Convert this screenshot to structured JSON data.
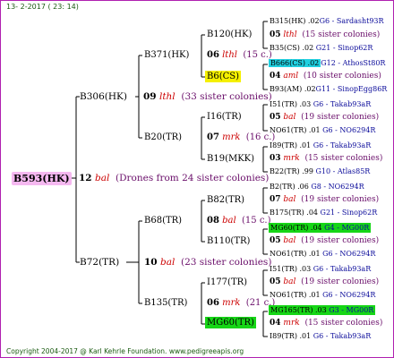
{
  "header": {
    "date": "13- 2-2017 ( 23: 14)"
  },
  "root": {
    "id": "B593(HK)",
    "drones_num": "12",
    "race": "bal",
    "note": "(Drones from 24 sister colonies)"
  },
  "gen2": [
    {
      "id": "B306(HK)",
      "num": "09",
      "race": "lthl",
      "note": "(33 sister colonies)"
    },
    {
      "id": "B72(TR)",
      "num": "10",
      "race": "bal",
      "note": "(23 sister colonies)"
    }
  ],
  "gen3": [
    {
      "id": "B371(HK)",
      "num": "06",
      "race": "lthl",
      "note": "(15 c.)"
    },
    {
      "id": "B20(TR)",
      "num": "07",
      "race": "mrk",
      "note": "(16 c.)"
    },
    {
      "id": "B68(TR)",
      "num": "08",
      "race": "bal",
      "note": "(15 c.)"
    },
    {
      "id": "B135(TR)",
      "num": "06",
      "race": "mrk",
      "note": "(21 c.)"
    }
  ],
  "gen4": [
    {
      "id": "B120(HK)",
      "num": "05",
      "race": "lthl",
      "note": "(15 sister colonies)"
    },
    {
      "id": "B6(CS)",
      "num": "04",
      "race": "aml",
      "note": "(10 sister colonies)"
    },
    {
      "id": "I16(TR)",
      "num": "05",
      "race": "bal",
      "note": "(19 sister colonies)"
    },
    {
      "id": "B19(MKK)",
      "num": "03",
      "race": "mrk",
      "note": "(15 sister colonies)"
    },
    {
      "id": "B82(TR)",
      "num": "07",
      "race": "bal",
      "note": "(19 sister colonies)"
    },
    {
      "id": "B110(TR)",
      "num": "05",
      "race": "bal",
      "note": "(19 sister colonies)"
    },
    {
      "id": "I177(TR)",
      "num": "05",
      "race": "bal",
      "note": "(19 sister colonies)"
    },
    {
      "id": "MG60(TR)",
      "num": "04",
      "race": "mrk",
      "note": "(15 sister colonies)"
    }
  ],
  "gen5": [
    {
      "id": "B315(HK) .02",
      "desc": "G6 - Sardasht93R"
    },
    {
      "id": "B35(CS) .02",
      "desc": "   G21 - Sinop62R"
    },
    {
      "id": "B666(CS) .02",
      "desc": "G12 - AthosSt80R"
    },
    {
      "id": "B93(AM) .02",
      "desc": "G11 - SinopEgg86R"
    },
    {
      "id": "I51(TR) .03",
      "desc": "   G6 - Takab93aR"
    },
    {
      "id": "NO61(TR) .01",
      "desc": "   G6 - NO6294R"
    },
    {
      "id": "I89(TR) .01",
      "desc": "   G6 - Takab93aR"
    },
    {
      "id": "B22(TR) .99",
      "desc": "   G10 - Atlas85R"
    },
    {
      "id": "B2(TR) .06",
      "desc": "   G8 - NO6294R"
    },
    {
      "id": "B175(TR) .04",
      "desc": " G21 - Sinop62R"
    },
    {
      "id": "MG60(TR) .04",
      "desc": "   G4 - MG00R"
    },
    {
      "id": "NO61(TR) .01",
      "desc": "   G6 - NO6294R"
    },
    {
      "id": "I51(TR) .03",
      "desc": "   G6 - Takab93aR"
    },
    {
      "id": "NO61(TR) .01",
      "desc": "   G6 - NO6294R"
    },
    {
      "id": "MG165(TR) .03",
      "desc": "   G3 - MG00R"
    },
    {
      "id": "I89(TR) .01",
      "desc": "   G6 - Takab93aR"
    }
  ],
  "footer": {
    "copyright": "Copyright 2004-2017 @ Karl Kehrle Foundation.    www.pedigreeapis.org"
  }
}
